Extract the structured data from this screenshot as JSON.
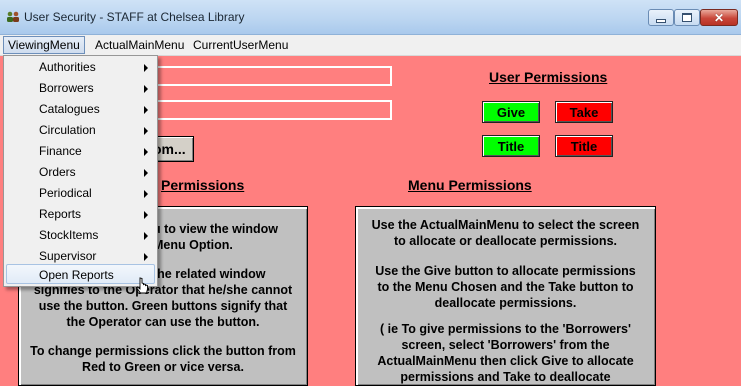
{
  "window": {
    "title": "User Security - STAFF at Chelsea Library",
    "icon": "users-icon",
    "controls": [
      "minimize-icon",
      "maximize-icon",
      "close-icon"
    ]
  },
  "menubar": {
    "items": [
      "ViewingMenu",
      "ActualMainMenu",
      "CurrentUserMenu"
    ],
    "active": "ViewingMenu"
  },
  "viewing_menu": {
    "items": [
      {
        "label": "Authorities",
        "submenu": true
      },
      {
        "label": "Borrowers",
        "submenu": true
      },
      {
        "label": "Catalogues",
        "submenu": true
      },
      {
        "label": "Circulation",
        "submenu": true
      },
      {
        "label": "Finance",
        "submenu": true
      },
      {
        "label": "Orders",
        "submenu": true
      },
      {
        "label": "Periodical",
        "submenu": true
      },
      {
        "label": "Reports",
        "submenu": true
      },
      {
        "label": "StockItems",
        "submenu": true
      },
      {
        "label": "Supervisor",
        "submenu": true
      },
      {
        "label": "Open Reports",
        "submenu": false
      }
    ],
    "hovered": "Open Reports"
  },
  "user_permissions": {
    "heading": "User Permissions",
    "give_label": "Give",
    "take_label": "Take",
    "title_green_label": "Title",
    "title_red_label": "Title"
  },
  "partial_button": {
    "label": "om..."
  },
  "left_panel": {
    "heading_partial": "Permissions",
    "lines": [
      "u to view the window",
      "Menu Option.",
      "the related window",
      "signifies to the Operator that he/she cannot",
      "use the button.  Green buttons signify that",
      "the Operator can use the button.",
      "To change permissions click the button from",
      "Red to Green or vice versa."
    ]
  },
  "menu_permissions": {
    "heading": "Menu Permissions",
    "paragraphs": [
      "Use the ActualMainMenu to select the screen to allocate or deallocate permissions.",
      "Use the Give button to allocate permissions to the Menu Chosen and the Take button to deallocate permissions.",
      "( ie To give permissions to the 'Borrowers' screen, select 'Borrowers' from the ActualMainMenu then click Give to allocate permissions and Take to deallocate"
    ]
  },
  "colors": {
    "background": "#ff7f7f",
    "give": "#00ff00",
    "take": "#ff0000",
    "panel": "#c0c0c0"
  }
}
